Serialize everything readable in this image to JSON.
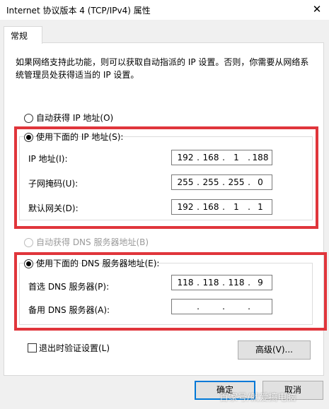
{
  "window": {
    "title": "Internet 协议版本 4 (TCP/IPv4) 属性",
    "close_glyph": "✕"
  },
  "tabs": [
    {
      "label": "常规"
    }
  ],
  "description": "如果网络支持此功能，则可以获取自动指派的 IP 设置。否则，你需要从网络系统管理员处获得适当的 IP 设置。",
  "ip": {
    "auto_label": "自动获得 IP 地址(O)",
    "manual_label": "使用下面的 IP 地址(S):",
    "fields": [
      {
        "label": "IP 地址(I):",
        "octets": [
          "192",
          "168",
          "1",
          "188"
        ]
      },
      {
        "label": "子网掩码(U):",
        "octets": [
          "255",
          "255",
          "255",
          "0"
        ]
      },
      {
        "label": "默认网关(D):",
        "octets": [
          "192",
          "168",
          "1",
          "1"
        ]
      }
    ]
  },
  "dns": {
    "auto_label": "自动获得 DNS 服务器地址(B)",
    "manual_label": "使用下面的 DNS 服务器地址(E):",
    "fields": [
      {
        "label": "首选 DNS 服务器(P):",
        "octets": [
          "118",
          "118",
          "118",
          "9"
        ]
      },
      {
        "label": "备用 DNS 服务器(A):",
        "octets": [
          "",
          "",
          "",
          ""
        ]
      }
    ]
  },
  "validate_label": "退出时验证设置(L)",
  "advanced_label": "高级(V)...",
  "ok_label": "确定",
  "cancel_label": "取消",
  "watermark": "百家号/就爱搞电脑",
  "colors": {
    "highlight_border": "#e0353b",
    "default_button_border": "#0078d7"
  }
}
